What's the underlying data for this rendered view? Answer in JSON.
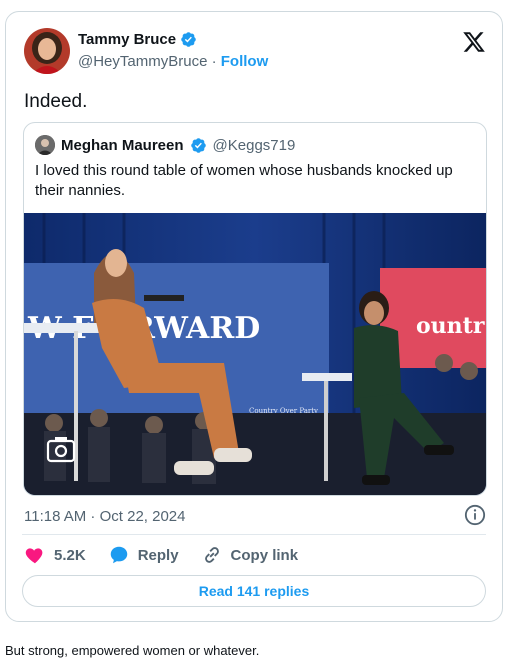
{
  "author": {
    "name": "Tammy Bruce",
    "handle": "@HeyTammyBruce",
    "separator": "·",
    "follow_label": "Follow"
  },
  "tweet": {
    "text": "Indeed.",
    "timestamp": "11:18 AM · Oct 22, 2024"
  },
  "quoted": {
    "name": "Meghan Maureen",
    "handle": "@Keggs719",
    "text": "I loved this round table of women whose husbands knocked up their nannies.",
    "image_signs": {
      "left": "W  F ORWARD",
      "right": "ountr",
      "small": "Country Over Party"
    }
  },
  "actions": {
    "likes": "5.2K",
    "reply_label": "Reply",
    "copy_label": "Copy link",
    "read_replies_label": "Read 141 replies"
  },
  "caption": "But strong, empowered women or whatever.",
  "colors": {
    "accent": "#1d9bf0",
    "like": "#f91880",
    "muted": "#536471",
    "border": "#cfd9de"
  },
  "icons": [
    "verified-badge-icon",
    "x-logo-icon",
    "info-icon",
    "heart-icon",
    "reply-icon",
    "link-icon",
    "camera-icon"
  ]
}
